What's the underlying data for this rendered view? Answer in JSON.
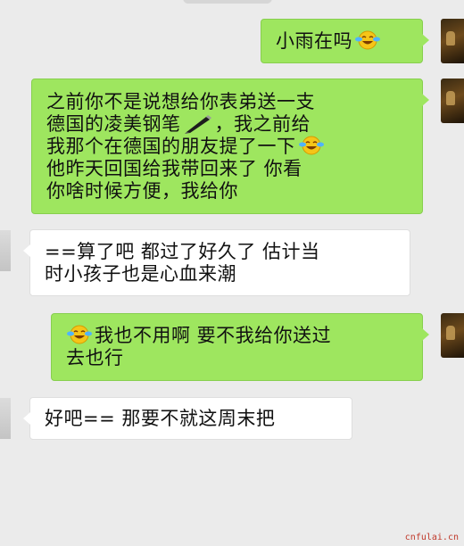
{
  "messages": [
    {
      "side": "right",
      "lines": [
        "小雨在吗"
      ]
    },
    {
      "side": "right",
      "lines": [
        "之前你不是说想给你表弟送一支",
        "德国的凌美钢笔",
        "，我之前给",
        "我那个在德国的朋友提了一下",
        "他昨天回国给我带回来了 你看",
        "你啥时候方便，我给你"
      ]
    },
    {
      "side": "left",
      "lines": [
        "==算了吧 都过了好久了 估计当",
        "时小孩子也是心血来潮"
      ]
    },
    {
      "side": "right",
      "lines": [
        "我也不用啊 要不我给你送过",
        "去也行"
      ]
    },
    {
      "side": "left",
      "lines": [
        "好吧== 那要不就这周末把"
      ]
    }
  ],
  "watermark": "cnfulai.cn"
}
